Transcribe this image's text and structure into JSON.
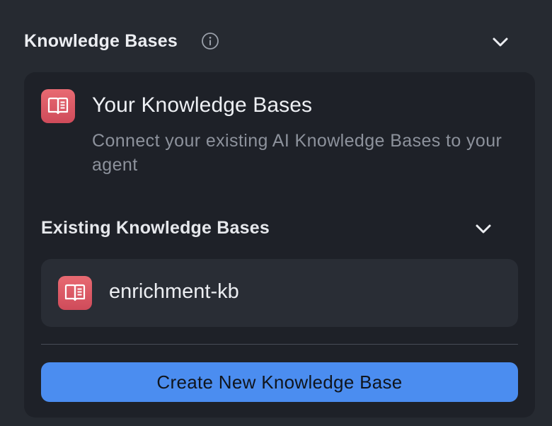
{
  "section": {
    "title": "Knowledge Bases",
    "info_icon": "info-circle-icon",
    "toggle_icon": "chevron-down-icon"
  },
  "card": {
    "icon": "book-icon",
    "title": "Your Knowledge Bases",
    "description": "Connect your existing AI Knowledge Bases to your agent"
  },
  "existing": {
    "title": "Existing Knowledge Bases",
    "toggle_icon": "chevron-down-icon",
    "items": [
      {
        "name": "enrichment-kb",
        "icon": "book-icon"
      }
    ]
  },
  "actions": {
    "create_label": "Create New Knowledge Base"
  },
  "colors": {
    "background": "#262a31",
    "card": "#1e2128",
    "item": "#292d35",
    "accent_button": "#4b8df0",
    "icon_badge": "#dd5a66"
  }
}
